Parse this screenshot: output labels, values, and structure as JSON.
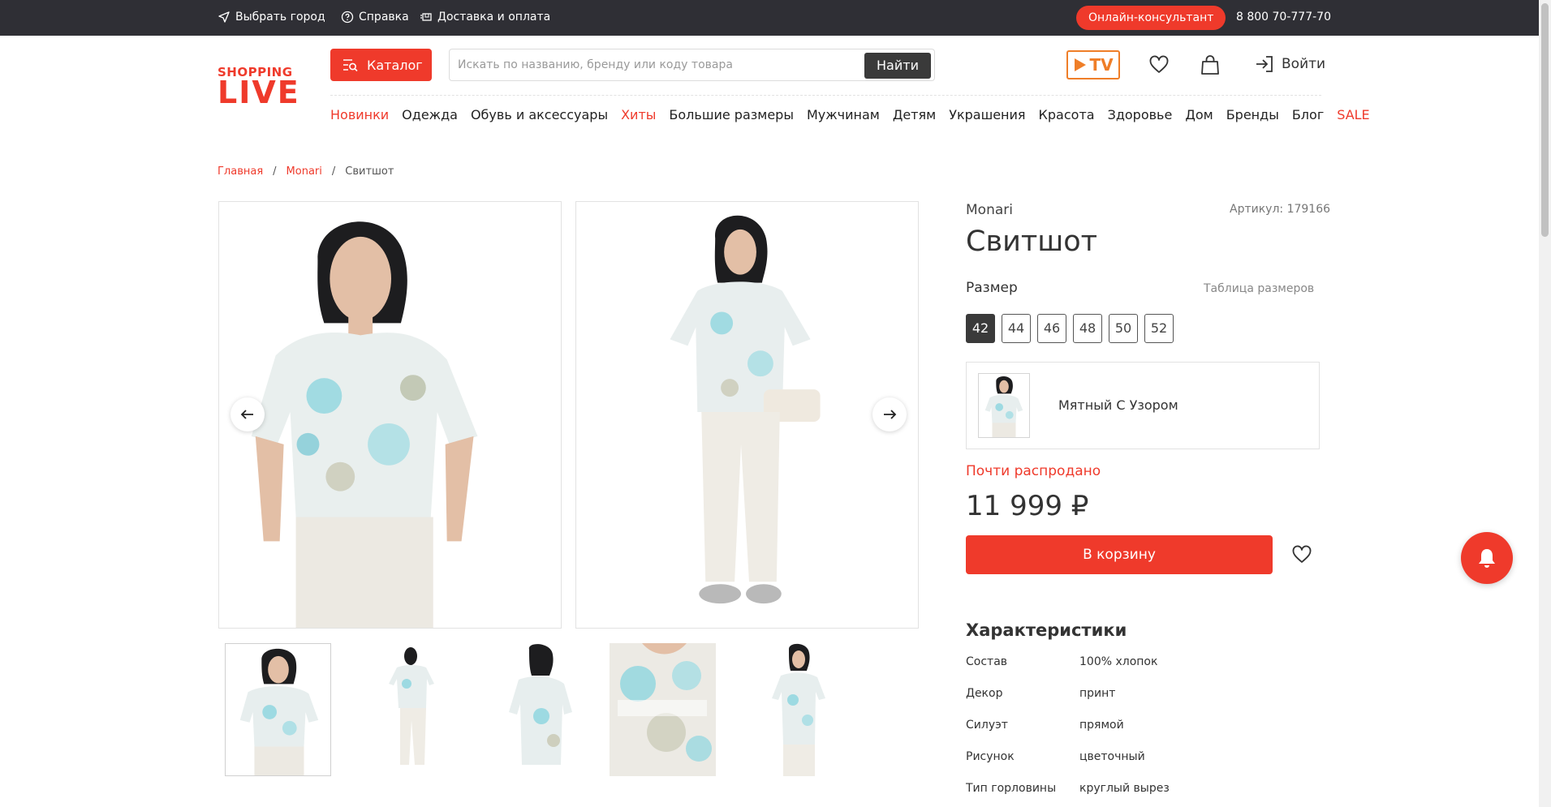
{
  "topbar": {
    "city": "Выбрать город",
    "help": "Справка",
    "delivery": "Доставка и оплата",
    "consultant": "Онлайн-консультант",
    "phone": "8 800 70-777-70"
  },
  "header": {
    "logo_top": "SHOPPING",
    "logo_bottom": "LIVE",
    "catalog": "Каталог",
    "search_placeholder": "Искать по названию, бренду или коду товара",
    "search_button": "Найти",
    "tv": "TV",
    "login": "Войти"
  },
  "nav": [
    {
      "label": "Новинки",
      "accent": true
    },
    {
      "label": "Одежда",
      "accent": false
    },
    {
      "label": "Обувь и аксессуары",
      "accent": false
    },
    {
      "label": "Хиты",
      "accent": true
    },
    {
      "label": "Большие размеры",
      "accent": false
    },
    {
      "label": "Мужчинам",
      "accent": false
    },
    {
      "label": "Детям",
      "accent": false
    },
    {
      "label": "Украшения",
      "accent": false
    },
    {
      "label": "Красота",
      "accent": false
    },
    {
      "label": "Здоровье",
      "accent": false
    },
    {
      "label": "Дом",
      "accent": false
    },
    {
      "label": "Бренды",
      "accent": false
    },
    {
      "label": "Блог",
      "accent": false
    },
    {
      "label": "SALE",
      "accent": true
    }
  ],
  "breadcrumbs": {
    "home": "Главная",
    "brand": "Monari",
    "current": "Свитшот",
    "separator": "/"
  },
  "product": {
    "brand": "Monari",
    "article": "Артикул: 179166",
    "title": "Свитшот",
    "size_label": "Размер",
    "size_table": "Таблица размеров",
    "sizes": [
      "42",
      "44",
      "46",
      "48",
      "50",
      "52"
    ],
    "selected_size": "42",
    "color_name": "Мятный С Узором",
    "stock_status": "Почти распродано",
    "price": "11 999 ₽",
    "cart_button": "В корзину"
  },
  "characteristics": {
    "title": "Характеристики",
    "rows": [
      {
        "key": "Состав",
        "value": "100% хлопок"
      },
      {
        "key": "Декор",
        "value": "принт"
      },
      {
        "key": "Силуэт",
        "value": "прямой"
      },
      {
        "key": "Рисунок",
        "value": "цветочный"
      },
      {
        "key": "Тип горловины",
        "value": "круглый вырез"
      }
    ]
  },
  "colors": {
    "accent": "#ef3a2b",
    "dark": "#2f2f35",
    "tv": "#ef7e28"
  }
}
